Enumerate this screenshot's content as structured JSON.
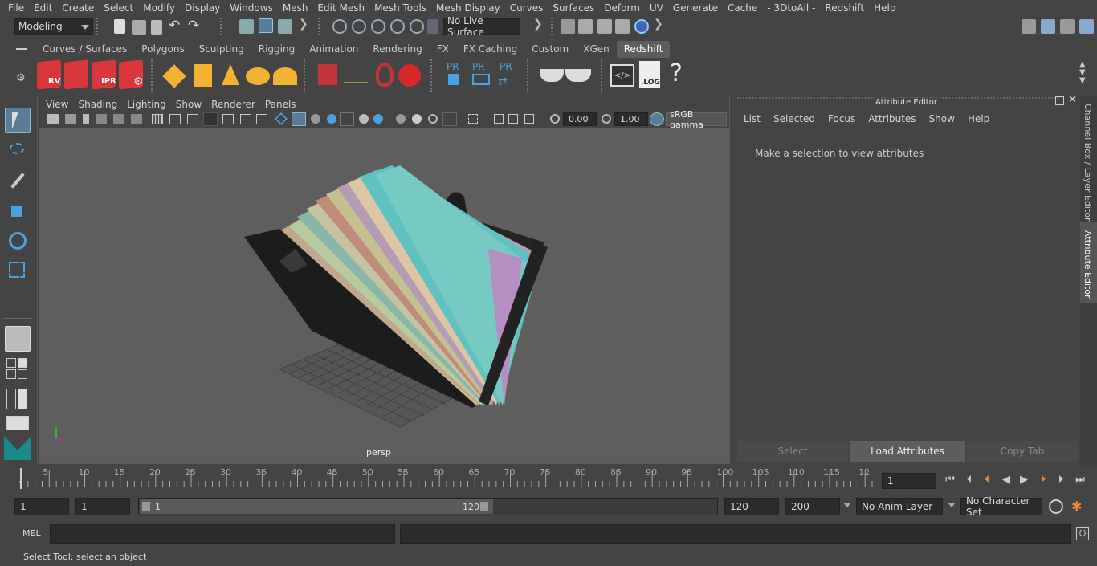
{
  "menubar": {
    "items": [
      "File",
      "Edit",
      "Create",
      "Select",
      "Modify",
      "Display",
      "Windows",
      "Mesh",
      "Edit Mesh",
      "Mesh Tools",
      "Mesh Display",
      "Curves",
      "Surfaces",
      "Deform",
      "UV",
      "Generate",
      "Cache",
      "- 3DtoAll -",
      "Redshift",
      "Help"
    ]
  },
  "toolbar": {
    "mode": "Modeling",
    "live_surface": "No Live Surface"
  },
  "shelf": {
    "tabs": [
      "Curves / Surfaces",
      "Polygons",
      "Sculpting",
      "Rigging",
      "Animation",
      "Rendering",
      "FX",
      "FX Caching",
      "Custom",
      "XGen",
      "Redshift"
    ],
    "active_tab": "Redshift",
    "icon_labels": {
      "rv": "RV",
      "ipr": "IPR",
      "pr": "PR",
      "log": ".LOG",
      "help": "?"
    }
  },
  "viewport": {
    "menu": [
      "View",
      "Shading",
      "Lighting",
      "Show",
      "Renderer",
      "Panels"
    ],
    "exposure": "0.00",
    "gamma": "1.00",
    "colorspace": "sRGB gamma",
    "camera": "persp"
  },
  "attribute_editor": {
    "title": "Attribute Editor",
    "menu": [
      "List",
      "Selected",
      "Focus",
      "Attributes",
      "Show",
      "Help"
    ],
    "message": "Make a selection to view attributes",
    "buttons": {
      "select": "Select",
      "load": "Load Attributes",
      "copy": "Copy Tab"
    }
  },
  "side_tabs": {
    "channel_box": "Channel Box / Layer Editor",
    "attribute_editor": "Attribute Editor"
  },
  "timeline": {
    "ticks": [
      "1",
      "5",
      "10",
      "15",
      "20",
      "25",
      "30",
      "35",
      "40",
      "45",
      "50",
      "55",
      "60",
      "65",
      "70",
      "75",
      "80",
      "85",
      "90",
      "95",
      "100",
      "105",
      "110",
      "115",
      "12"
    ],
    "current_frame": "1"
  },
  "range": {
    "start": "1",
    "playback_start": "1",
    "slider_start": "1",
    "slider_end": "120",
    "playback_end": "120",
    "end": "200",
    "anim_layer": "No Anim Layer",
    "character_set": "No Character Set"
  },
  "command": {
    "language": "MEL"
  },
  "status": {
    "text": "Select Tool: select an object"
  },
  "colors": {
    "bg": "#444444",
    "viewport_bg": "#5e5e5e",
    "field_bg": "#2b2b2b",
    "active_tab": "#5d5d5d",
    "redshift_red": "#d9373a",
    "accent_blue": "#4aa3df"
  }
}
